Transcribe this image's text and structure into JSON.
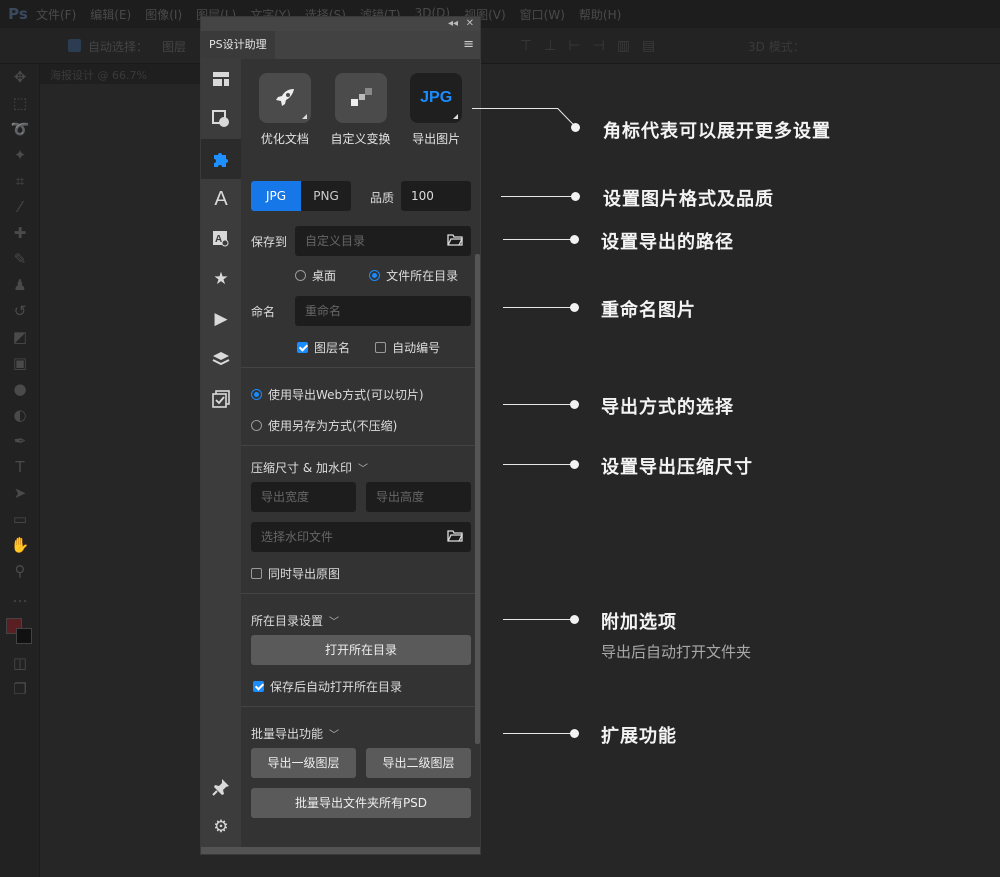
{
  "ps": {
    "logo": "Ps",
    "menu": [
      "文件(F)",
      "编辑(E)",
      "图像(I)",
      "图层(L)",
      "文字(Y)",
      "选择(S)",
      "滤镜(T)",
      "3D(D)",
      "视图(V)",
      "窗口(W)",
      "帮助(H)"
    ],
    "options": {
      "auto_select": "自动选择：",
      "layer": "图层",
      "mode_3d": "3D 模式："
    },
    "doc_tab": "海报设计 @ 66.7%"
  },
  "panel": {
    "tab_title": "PS设计助理",
    "collapse_label": "◂◂",
    "close_label": "✕",
    "menu_label": "≡",
    "tools": [
      {
        "label": "优化文档",
        "icon": "rocket-icon"
      },
      {
        "label": "自定义变换",
        "icon": "blocks-icon"
      },
      {
        "label": "导出图片",
        "icon": "jpg-badge",
        "badge": "JPG"
      }
    ],
    "format": {
      "jpg": "JPG",
      "png": "PNG",
      "quality_label": "品质",
      "quality_value": "100"
    },
    "save_to": {
      "label": "保存到",
      "placeholder": "自定义目录",
      "opt_desktop": "桌面",
      "opt_file_dir": "文件所在目录",
      "selected": "文件所在目录"
    },
    "rename": {
      "label": "命名",
      "placeholder": "重命名",
      "opt_layer_name": "图层名",
      "opt_auto_number": "自动编号",
      "layer_name_checked": true,
      "auto_number_checked": false
    },
    "export_mode": {
      "web": "使用导出Web方式(可以切片)",
      "save_as": "使用另存为方式(不压缩)",
      "selected": "web"
    },
    "compress": {
      "title": "压缩尺寸 & 加水印",
      "width_placeholder": "导出宽度",
      "height_placeholder": "导出高度",
      "watermark_placeholder": "选择水印文件",
      "export_original": "同时导出原图"
    },
    "dir_settings": {
      "title": "所在目录设置",
      "open_button": "打开所在目录",
      "auto_open": "保存后自动打开所在目录",
      "auto_open_checked": true
    },
    "batch": {
      "title": "批量导出功能",
      "level1": "导出一级图层",
      "level2": "导出二级图层",
      "batch_psd": "批量导出文件夹所有PSD"
    }
  },
  "annotations": [
    {
      "text": "角标代表可以展开更多设置"
    },
    {
      "text": "设置图片格式及品质"
    },
    {
      "text": "设置导出的路径"
    },
    {
      "text": "重命名图片"
    },
    {
      "text": "导出方式的选择"
    },
    {
      "text": "设置导出压缩尺寸"
    },
    {
      "text": "附加选项",
      "sub": "导出后自动打开文件夹"
    },
    {
      "text": "扩展功能"
    }
  ],
  "colors": {
    "accent": "#1677e8",
    "jpg_blue": "#1a8cff",
    "bg": "#262626",
    "panel_content": "#333333",
    "foreground_swatch": "#5a1f22"
  }
}
